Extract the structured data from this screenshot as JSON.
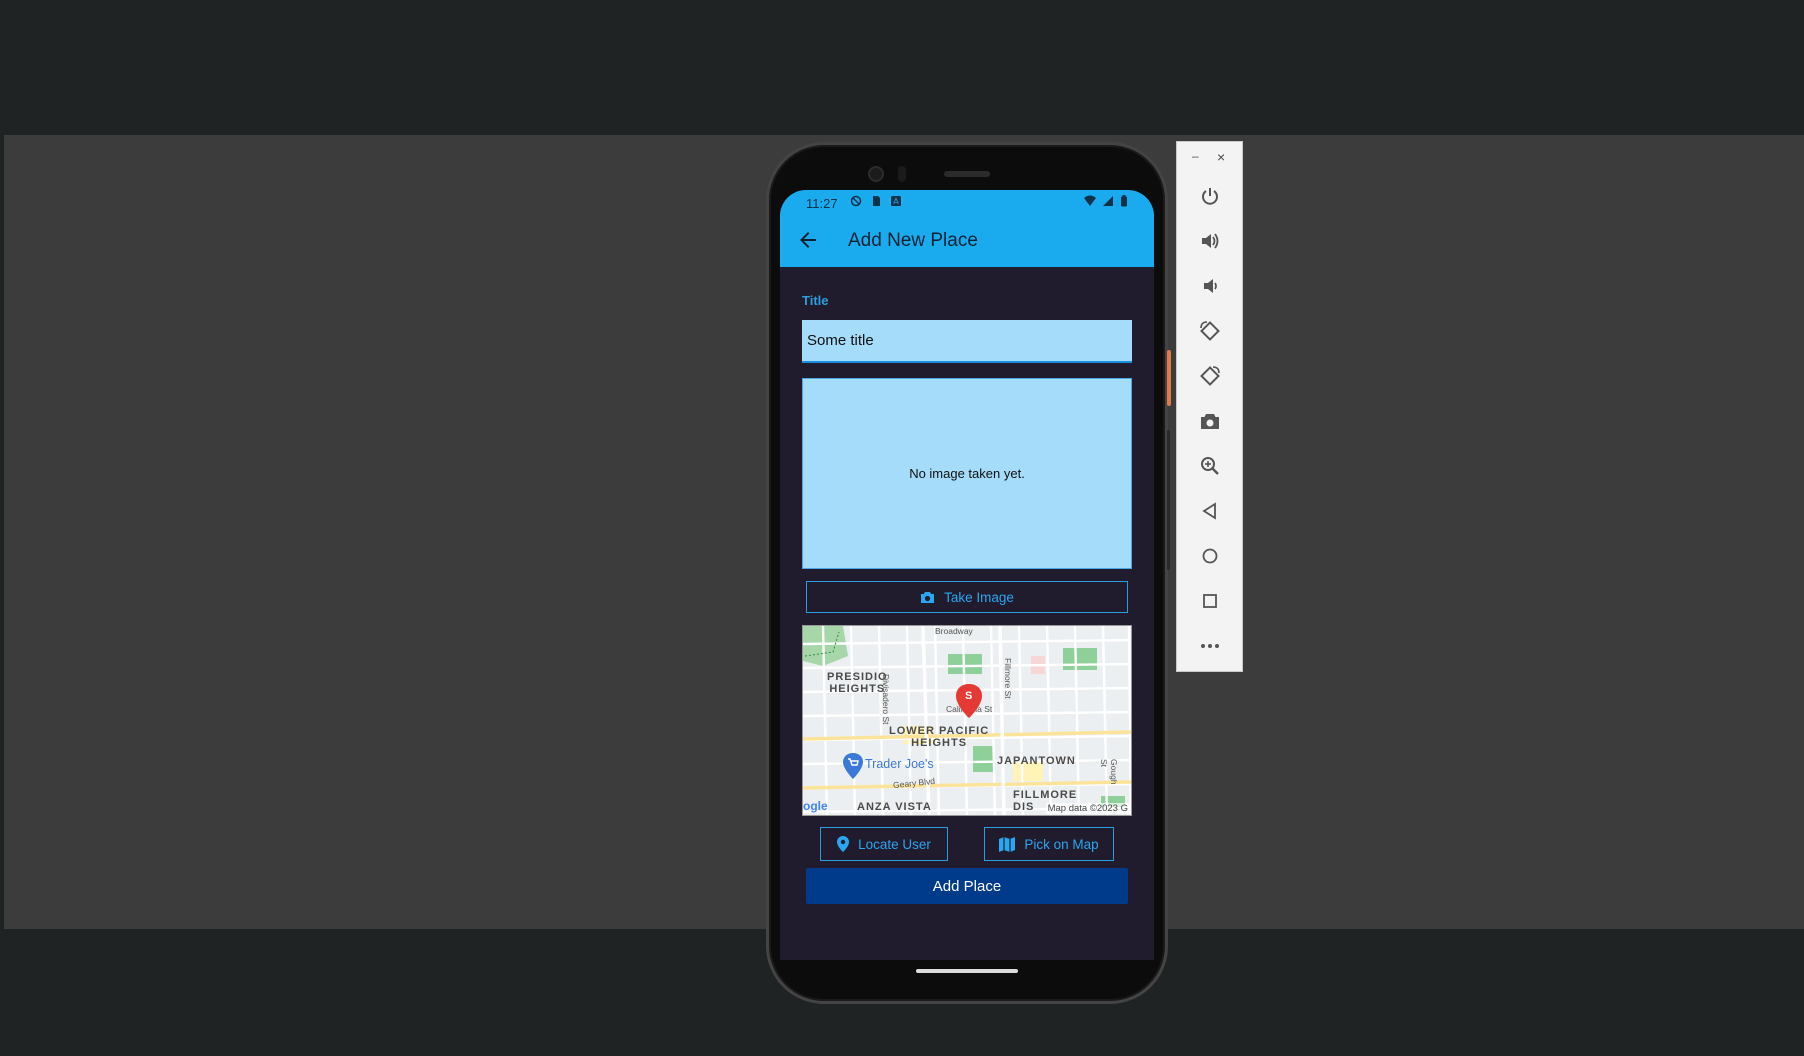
{
  "statusbar": {
    "time": "11:27"
  },
  "appbar": {
    "title": "Add New Place"
  },
  "form": {
    "title_label": "Title",
    "title_value": "Some title",
    "image_placeholder": "No image taken yet.",
    "take_image_label": "Take Image",
    "locate_user_label": "Locate User",
    "pick_on_map_label": "Pick on Map",
    "add_place_label": "Add Place"
  },
  "map": {
    "labels": {
      "presidio": "PRESIDIO\nHEIGHTS",
      "lower_pacific": "LOWER PACIFIC\nHEIGHTS",
      "japantown": "JAPANTOWN",
      "anza": "ANZA VISTA",
      "fillmore": "FILLMORE\nDIS",
      "trader": "Trader Joe's",
      "broadway": "Broadway",
      "divisadero": "Divisadero St",
      "fillmore_st": "Fillmore St",
      "california": "California St",
      "geary": "Geary Blvd",
      "gough": "Gough St",
      "google": "ogle",
      "mapdata": "Map data ©2023 G",
      "marker": "S"
    }
  },
  "colors": {
    "appbar": "#1aabef",
    "background": "#211b2e",
    "accent": "#2a9fe0",
    "primary_button": "#003a8a",
    "input_fill": "#a5dcfa"
  },
  "toolbar": {
    "minimize": "–",
    "close": "×",
    "buttons": [
      "power-icon",
      "volume-up-icon",
      "volume-down-icon",
      "rotate-left-icon",
      "rotate-right-icon",
      "camera-icon",
      "zoom-icon",
      "back-icon",
      "home-icon",
      "overview-icon",
      "more-icon"
    ]
  }
}
